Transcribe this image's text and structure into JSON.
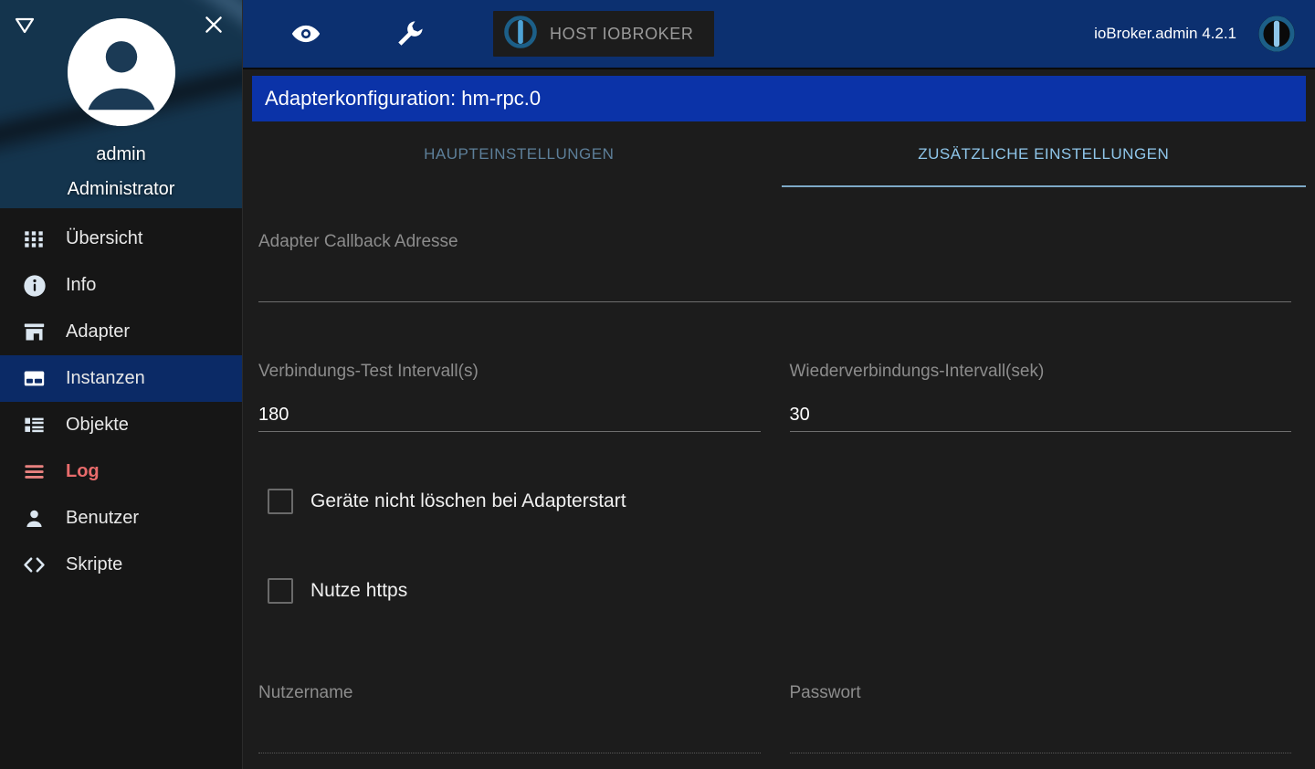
{
  "sidebar": {
    "collapse_icon": "triangle-down-icon",
    "close_icon": "close-icon",
    "avatar_icon": "person-avatar-icon",
    "user_name": "admin",
    "user_role": "Administrator",
    "items": [
      {
        "label": "Übersicht",
        "icon": "grid-icon",
        "selected": false
      },
      {
        "label": "Info",
        "icon": "info-icon",
        "selected": false
      },
      {
        "label": "Adapter",
        "icon": "store-icon",
        "selected": false
      },
      {
        "label": "Instanzen",
        "icon": "instances-icon",
        "selected": true
      },
      {
        "label": "Objekte",
        "icon": "list-icon",
        "selected": false
      },
      {
        "label": "Log",
        "icon": "lines-icon",
        "selected": false
      },
      {
        "label": "Benutzer",
        "icon": "person-icon",
        "selected": false
      },
      {
        "label": "Skripte",
        "icon": "code-icon",
        "selected": false
      }
    ]
  },
  "toolbar": {
    "eye_icon": "eye-icon",
    "wrench_icon": "wrench-icon",
    "host_button_label": "HOST IOBROKER",
    "host_logo_icon": "iobroker-logo-icon",
    "version_label": "ioBroker.admin 4.2.1",
    "logo_icon": "iobroker-logo-icon"
  },
  "page": {
    "title": "Adapterkonfiguration: hm-rpc.0"
  },
  "tabs": [
    {
      "label": "HAUPTEINSTELLUNGEN",
      "active": false
    },
    {
      "label": "ZUSÄTZLICHE EINSTELLUNGEN",
      "active": true
    }
  ],
  "form": {
    "callback_address": {
      "label": "Adapter Callback Adresse",
      "value": ""
    },
    "connection_test_interval": {
      "label": "Verbindungs-Test Intervall(s)",
      "value": "180"
    },
    "reconnect_interval": {
      "label": "Wiederverbindungs-Intervall(sek)",
      "value": "30"
    },
    "checkboxes": [
      {
        "label": "Geräte nicht löschen bei Adapterstart",
        "checked": false
      },
      {
        "label": "Nutze https",
        "checked": false
      }
    ],
    "username": {
      "label": "Nutzername",
      "value": ""
    },
    "password": {
      "label": "Passwort",
      "value": ""
    }
  },
  "colors": {
    "toolbar_blue": "#0c3070",
    "title_blue": "#0b33a8",
    "selected_nav": "#0b2a66",
    "background": "#1c1c1c",
    "sidebar": "#161616",
    "tab_active": "#8fc6ea",
    "tab_inactive": "#5d7f99",
    "log_red": "#e86b6b"
  }
}
